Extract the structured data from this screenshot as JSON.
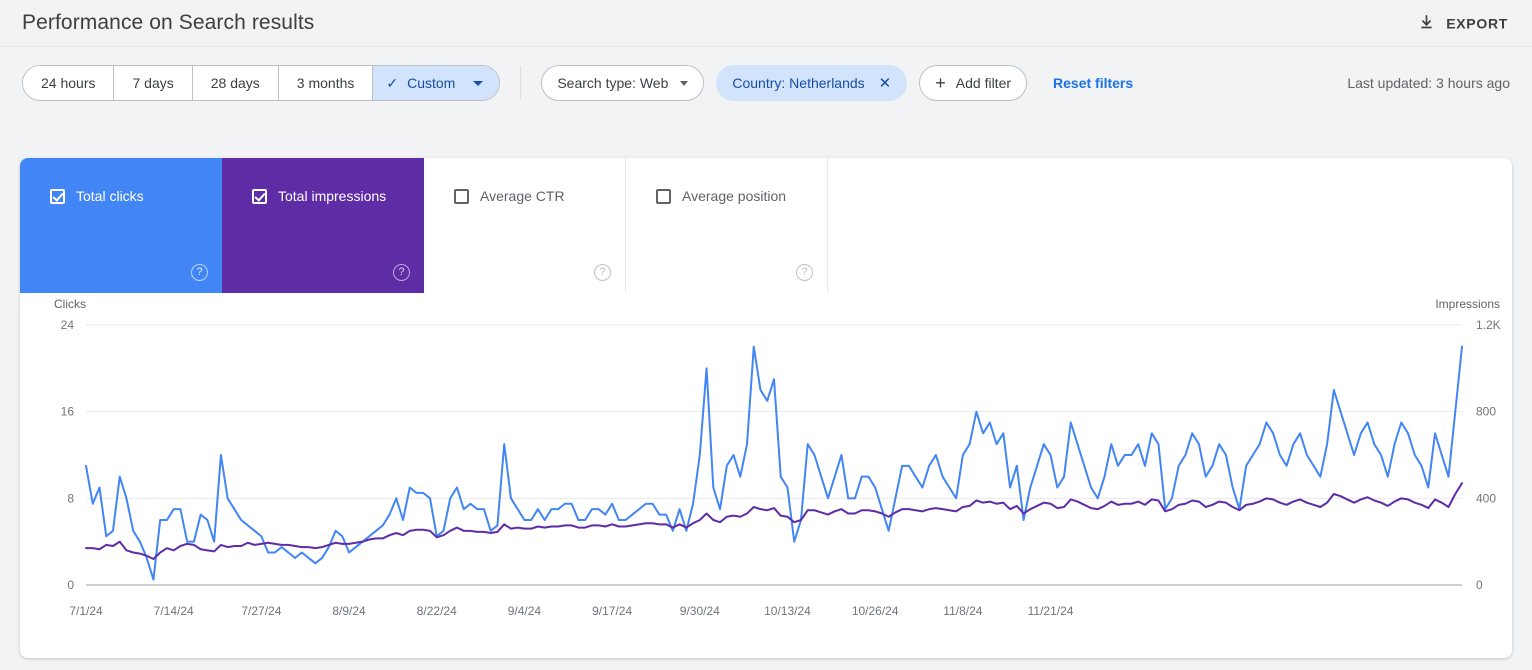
{
  "header": {
    "title": "Performance on Search results",
    "export_label": "EXPORT",
    "export_icon": "download-icon"
  },
  "filters": {
    "date_ranges": [
      {
        "label": "24 hours",
        "active": false
      },
      {
        "label": "7 days",
        "active": false
      },
      {
        "label": "28 days",
        "active": false
      },
      {
        "label": "3 months",
        "active": false
      },
      {
        "label": "Custom",
        "active": true,
        "check": "✓",
        "caret": "dropdown-caret"
      }
    ],
    "search_type": {
      "label": "Search type: Web",
      "caret": "dropdown-caret"
    },
    "country": {
      "label": "Country: Netherlands",
      "remove": "✕"
    },
    "add_filter": {
      "label": "Add filter",
      "plus": "+"
    },
    "reset": "Reset filters",
    "last_updated": "Last updated: 3 hours ago"
  },
  "metrics": [
    {
      "label": "Total clicks",
      "checked": true,
      "state": "selected-blue",
      "help": "?"
    },
    {
      "label": "Total impressions",
      "checked": true,
      "state": "selected-purple",
      "help": "?"
    },
    {
      "label": "Average CTR",
      "checked": false,
      "state": "unselected",
      "help": "?"
    },
    {
      "label": "Average position",
      "checked": false,
      "state": "unselected",
      "help": "?"
    }
  ],
  "colors": {
    "clicks_line": "#4285f4",
    "impressions_line": "#5e2ca5",
    "selected_blue": "#4285f4",
    "selected_purple": "#5e2ca5",
    "accent_link": "#1a73e8",
    "chip_selected_bg": "#d2e3fc",
    "page_bg": "#f1f3f4"
  },
  "chart_data": {
    "type": "line",
    "title": "",
    "grid": true,
    "legend_position": "metric-cards",
    "xlabel": "",
    "x_tick_labels": [
      "7/1/24",
      "7/14/24",
      "7/27/24",
      "8/9/24",
      "8/22/24",
      "9/4/24",
      "9/17/24",
      "9/30/24",
      "10/13/24",
      "10/26/24",
      "11/8/24",
      "11/21/24"
    ],
    "x_tick_indices": [
      0,
      13,
      26,
      39,
      52,
      65,
      78,
      91,
      104,
      117,
      130,
      143
    ],
    "axes": [
      {
        "side": "left",
        "label": "Clicks",
        "ticks": [
          "0",
          "8",
          "16",
          "24"
        ],
        "tick_values": [
          0,
          8,
          16,
          24
        ],
        "ylim": [
          0,
          24
        ]
      },
      {
        "side": "right",
        "label": "Impressions",
        "ticks": [
          "0",
          "400",
          "800",
          "1.2K"
        ],
        "tick_values": [
          0,
          400,
          800,
          1200
        ],
        "ylim": [
          0,
          1200
        ]
      }
    ],
    "series": [
      {
        "name": "Total clicks",
        "color": "#4285f4",
        "axis": "left",
        "values": [
          11,
          7.5,
          9,
          4.5,
          5,
          10,
          8,
          5,
          4,
          2.5,
          0.5,
          6,
          6,
          7,
          7,
          4,
          4,
          6.5,
          6,
          4,
          12,
          8,
          7,
          6,
          5.5,
          5,
          4.5,
          3,
          3,
          3.5,
          3,
          2.5,
          3,
          2.5,
          2,
          2.5,
          3.5,
          5,
          4.5,
          3,
          3.5,
          4,
          4.5,
          5,
          5.5,
          6.5,
          8,
          6,
          9,
          8.5,
          8.5,
          8,
          4.5,
          5,
          8,
          9,
          7,
          7.5,
          7,
          7,
          5,
          5.5,
          13,
          8,
          7,
          6,
          6,
          7,
          6,
          7,
          7,
          7.5,
          7.5,
          6,
          6,
          7,
          7,
          6.5,
          7.5,
          6,
          6,
          6.5,
          7,
          7.5,
          7.5,
          6.5,
          6.5,
          5,
          7,
          5,
          7.5,
          12,
          20,
          9,
          7,
          11,
          12,
          10,
          13,
          22,
          18,
          17,
          19,
          10,
          9,
          4,
          6,
          13,
          12,
          10,
          8,
          10,
          12,
          8,
          8,
          10,
          10,
          9,
          7,
          5,
          8,
          11,
          11,
          10,
          9,
          11,
          12,
          10,
          9,
          8,
          12,
          13,
          16,
          14,
          15,
          13,
          14,
          9,
          11,
          6,
          9,
          11,
          13,
          12,
          9,
          10,
          15,
          13,
          11,
          9,
          8,
          10,
          13,
          11,
          12,
          12,
          13,
          11,
          14,
          13,
          7,
          8,
          11,
          12,
          14,
          13,
          10,
          11,
          13,
          12,
          9,
          7,
          11,
          12,
          13,
          15,
          14,
          12,
          11,
          13,
          14,
          12,
          11,
          10,
          13,
          18,
          16,
          14,
          12,
          14,
          15,
          13,
          12,
          10,
          13,
          15,
          14,
          12,
          11,
          9,
          14,
          12,
          10,
          16,
          22
        ]
      },
      {
        "name": "Total impressions",
        "color": "#5e2ca5",
        "axis": "right",
        "values": [
          170,
          170,
          165,
          185,
          180,
          200,
          160,
          150,
          145,
          135,
          120,
          150,
          170,
          160,
          180,
          190,
          185,
          165,
          160,
          155,
          185,
          175,
          180,
          180,
          195,
          185,
          190,
          195,
          190,
          185,
          185,
          180,
          175,
          175,
          170,
          175,
          185,
          195,
          190,
          190,
          195,
          200,
          210,
          215,
          215,
          230,
          240,
          230,
          250,
          255,
          255,
          250,
          220,
          230,
          250,
          265,
          250,
          250,
          245,
          245,
          240,
          245,
          280,
          260,
          265,
          260,
          260,
          270,
          265,
          270,
          270,
          275,
          275,
          265,
          265,
          275,
          275,
          270,
          280,
          270,
          270,
          275,
          280,
          285,
          285,
          280,
          280,
          265,
          280,
          265,
          285,
          300,
          330,
          300,
          290,
          315,
          320,
          315,
          330,
          360,
          350,
          345,
          355,
          320,
          315,
          290,
          300,
          345,
          345,
          335,
          325,
          340,
          350,
          330,
          330,
          345,
          345,
          340,
          330,
          315,
          335,
          350,
          350,
          345,
          340,
          350,
          355,
          350,
          345,
          340,
          360,
          365,
          390,
          380,
          385,
          375,
          380,
          350,
          365,
          330,
          350,
          365,
          380,
          375,
          355,
          360,
          395,
          385,
          370,
          355,
          350,
          365,
          385,
          370,
          375,
          375,
          385,
          370,
          395,
          390,
          340,
          350,
          370,
          375,
          390,
          385,
          360,
          370,
          385,
          380,
          360,
          345,
          370,
          375,
          385,
          400,
          395,
          380,
          370,
          385,
          395,
          380,
          370,
          360,
          380,
          420,
          410,
          395,
          380,
          395,
          405,
          390,
          380,
          365,
          385,
          400,
          395,
          380,
          370,
          355,
          395,
          380,
          360,
          420,
          470
        ]
      }
    ]
  }
}
